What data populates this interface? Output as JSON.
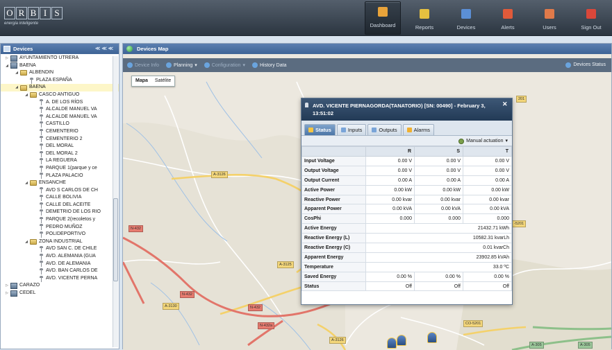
{
  "app": {
    "logo_letters": [
      "O",
      "R",
      "B",
      "I",
      "S"
    ],
    "logo_tagline": "energia inteligente"
  },
  "nav": [
    {
      "label": "Dashboard",
      "icon": "home-icon",
      "color": "#e8a33a",
      "active": true
    },
    {
      "label": "Reports",
      "icon": "report-icon",
      "color": "#e5c040",
      "active": false
    },
    {
      "label": "Devices",
      "icon": "devices-icon",
      "color": "#5b8fd6",
      "active": false
    },
    {
      "label": "Alerts",
      "icon": "alerts-icon",
      "color": "#e05a3a",
      "active": false
    },
    {
      "label": "Users",
      "icon": "users-icon",
      "color": "#e07a4a",
      "active": false
    },
    {
      "label": "Sign Out",
      "icon": "sign-out-icon",
      "color": "#d9473a",
      "active": false
    }
  ],
  "left_panel": {
    "title": "Devices",
    "tree": [
      {
        "level": 0,
        "kind": "city",
        "label": "AYUNTAMIENTO UTRERA",
        "expand": "▷"
      },
      {
        "level": 0,
        "kind": "city",
        "label": "BAENA",
        "expand": "◢"
      },
      {
        "level": 1,
        "kind": "folder",
        "label": "ALBENDIN",
        "expand": "◢"
      },
      {
        "level": 2,
        "kind": "lamp",
        "label": "PLAZA ESPAÑA",
        "expand": ""
      },
      {
        "level": 1,
        "kind": "folder",
        "label": "BAENA",
        "expand": "◢",
        "selected": true
      },
      {
        "level": 2,
        "kind": "folder",
        "label": "CASCO ANTIGUO",
        "expand": "◢"
      },
      {
        "level": 3,
        "kind": "lamp",
        "label": "A. DE LOS RÍOS",
        "expand": ""
      },
      {
        "level": 3,
        "kind": "lamp",
        "label": "ALCALDE MANUEL VA",
        "expand": ""
      },
      {
        "level": 3,
        "kind": "lamp",
        "label": "ALCALDE MANUEL VA",
        "expand": ""
      },
      {
        "level": 3,
        "kind": "lamp",
        "label": "CASTILLO",
        "expand": ""
      },
      {
        "level": 3,
        "kind": "lamp",
        "label": "CEMENTERIO",
        "expand": ""
      },
      {
        "level": 3,
        "kind": "lamp",
        "label": "CEMENTERIO 2",
        "expand": ""
      },
      {
        "level": 3,
        "kind": "lamp",
        "label": "DEL MORAL",
        "expand": ""
      },
      {
        "level": 3,
        "kind": "lamp",
        "label": "DEL MORAL 2",
        "expand": ""
      },
      {
        "level": 3,
        "kind": "lamp",
        "label": "LA REGUERA",
        "expand": ""
      },
      {
        "level": 3,
        "kind": "lamp",
        "label": "PARQUE 1(parque y ce",
        "expand": ""
      },
      {
        "level": 3,
        "kind": "lamp",
        "label": "PLAZA PALACIO",
        "expand": ""
      },
      {
        "level": 2,
        "kind": "folder",
        "label": "ENSANCHE",
        "expand": "◢"
      },
      {
        "level": 3,
        "kind": "lamp",
        "label": "AVD S CARLOS DE CH",
        "expand": ""
      },
      {
        "level": 3,
        "kind": "lamp",
        "label": "CALLE BOLIVIA",
        "expand": ""
      },
      {
        "level": 3,
        "kind": "lamp",
        "label": "CALLE DEL ACEITE",
        "expand": ""
      },
      {
        "level": 3,
        "kind": "lamp",
        "label": "DEMETRIO DE LOS RIO",
        "expand": ""
      },
      {
        "level": 3,
        "kind": "lamp",
        "label": "PARQUE 2(recoletos y",
        "expand": ""
      },
      {
        "level": 3,
        "kind": "lamp",
        "label": "PEDRO MUÑOZ",
        "expand": ""
      },
      {
        "level": 3,
        "kind": "lamp",
        "label": "POLIDEPORTIVO",
        "expand": ""
      },
      {
        "level": 2,
        "kind": "folder",
        "label": "ZONA INDUSTRIAL",
        "expand": "◢"
      },
      {
        "level": 3,
        "kind": "lamp",
        "label": "AVD SAN C. DE CHILE",
        "expand": ""
      },
      {
        "level": 3,
        "kind": "lamp",
        "label": "AVD. ALEMANIA (GUA",
        "expand": ""
      },
      {
        "level": 3,
        "kind": "lamp",
        "label": "AVD. DE ALEMANIA",
        "expand": ""
      },
      {
        "level": 3,
        "kind": "lamp",
        "label": "AVD. BAN CARLOS DE",
        "expand": ""
      },
      {
        "level": 3,
        "kind": "lamp",
        "label": "AVD. VICENTE PERNA",
        "expand": ""
      },
      {
        "level": 0,
        "kind": "city",
        "label": "CARAZO",
        "expand": "▷"
      },
      {
        "level": 0,
        "kind": "city",
        "label": "CEDEL",
        "expand": "▷"
      }
    ]
  },
  "map_panel": {
    "title": "Devices Map",
    "toolbar": [
      {
        "label": "Device Info",
        "dim": true,
        "icon": "info-icon"
      },
      {
        "label": "Planning",
        "dim": false,
        "icon": "planning-icon",
        "dropdown": true
      },
      {
        "label": "Configuration",
        "dim": true,
        "icon": "configuration-icon",
        "dropdown": true
      },
      {
        "label": "History Data",
        "dim": false,
        "icon": "history-icon"
      }
    ],
    "status_button": "Devices Status",
    "map_types": [
      "Mapa",
      "Satélite"
    ],
    "road_labels": [
      {
        "text": "A-3126",
        "bg": "#f3d67a"
      },
      {
        "text": "N-432",
        "bg": "#e77b6f"
      },
      {
        "text": "A-3125",
        "bg": "#f3d67a"
      },
      {
        "text": "N-432",
        "bg": "#e77b6f"
      },
      {
        "text": "N-432",
        "bg": "#e77b6f"
      },
      {
        "text": "A-3130",
        "bg": "#f3d67a"
      },
      {
        "text": "N-432a",
        "bg": "#e77b6f"
      },
      {
        "text": "A-3126",
        "bg": "#f3d67a"
      },
      {
        "text": "CO-5201",
        "bg": "#f3d67a"
      },
      {
        "text": "-5201",
        "bg": "#f3d67a"
      },
      {
        "text": "201",
        "bg": "#f3d67a"
      },
      {
        "text": "A-305",
        "bg": "#9bc79a"
      },
      {
        "text": "A-305",
        "bg": "#9bc79a"
      }
    ]
  },
  "popup": {
    "title": "AVD. VICENTE PIERNAGORDA(TANATORIO) [SN: 00490] - February 3, 13:51:02",
    "tabs": [
      {
        "label": "Status",
        "active": true,
        "icon_color": "#f5c542"
      },
      {
        "label": "Inputs",
        "active": false,
        "icon_color": "#7aa5d8"
      },
      {
        "label": "Outputs",
        "active": false,
        "icon_color": "#7aa5d8"
      },
      {
        "label": "Alarms",
        "active": false,
        "icon_color": "#f0b030"
      }
    ],
    "manual_actuation": "Manual actuation",
    "columns": [
      "R",
      "S",
      "T"
    ],
    "rows_3": [
      {
        "label": "Input Voltage",
        "values": [
          "0.00 V",
          "0.00 V",
          "0.00 V"
        ]
      },
      {
        "label": "Output Voltage",
        "values": [
          "0.00 V",
          "0.00 V",
          "0.00 V"
        ]
      },
      {
        "label": "Output Current",
        "values": [
          "0.00 A",
          "0.00 A",
          "0.00 A"
        ]
      },
      {
        "label": "Active Power",
        "values": [
          "0.00 kW",
          "0.00 kW",
          "0.00 kW"
        ]
      },
      {
        "label": "Reactive Power",
        "values": [
          "0.00 kvar",
          "0.00 kvar",
          "0.00 kvar"
        ]
      },
      {
        "label": "Apparent Power",
        "values": [
          "0.00 kVA",
          "0.00 kVA",
          "0.00 kVA"
        ]
      },
      {
        "label": "CosPhi",
        "values": [
          "0.000",
          "0.000",
          "0.000"
        ]
      }
    ],
    "rows_1": [
      {
        "label": "Active Energy",
        "value": "21432.71 kWh"
      },
      {
        "label": "Reactive Energy (L)",
        "value": "10582.31 kvarLh"
      },
      {
        "label": "Reactive Energy (C)",
        "value": "0.01 kvarCh"
      },
      {
        "label": "Apparent Energy",
        "value": "23902.85 kVAh"
      },
      {
        "label": "Temperature",
        "value": "33.0 ºC"
      }
    ],
    "rows_tail": [
      {
        "label": "Saved Energy",
        "values": [
          "0.00 %",
          "0.00 %",
          "0.00 %"
        ]
      },
      {
        "label": "Status",
        "values": [
          "Off",
          "Off",
          "Off"
        ]
      }
    ]
  }
}
